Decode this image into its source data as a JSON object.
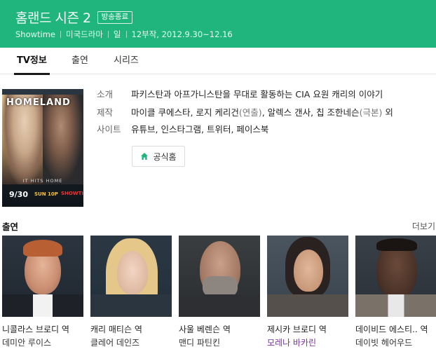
{
  "header": {
    "title": "홈랜드 시즌 2",
    "badge": "방송종료",
    "meta": [
      "Showtime",
      "미국드라마",
      "일",
      "12부작, 2012.9.30~12.16"
    ],
    "color": "#1fb57d"
  },
  "tabs": [
    {
      "label": "TV정보",
      "active": true
    },
    {
      "label": "출연",
      "active": false
    },
    {
      "label": "시리즈",
      "active": false
    }
  ],
  "poster": {
    "logo_text": "HOMELAND",
    "tagline": "IT HITS HOME",
    "date": "9/30",
    "date_sub": "SUN 10P",
    "network": "SHOWTIME"
  },
  "info": {
    "synopsis_label": "소개",
    "synopsis": "파키스탄과 아프가니스탄을 무대로 활동하는 CIA 요원 캐리의 이야기",
    "production_label": "제작",
    "production": {
      "person1": "마이클 쿠에스타",
      "person2": "로지 케리건",
      "person2_role": "(연출)",
      "person3": "알렉스 갠사",
      "person4": "칩 조한네슨",
      "person4_role": "(극본)",
      "suffix": "외"
    },
    "sites_label": "사이트",
    "sites": [
      "유튜브",
      "인스타그램",
      "트위터",
      "페이스북"
    ]
  },
  "home_button": {
    "label": "공식홈",
    "icon": "home-icon"
  },
  "cast": {
    "title": "출연",
    "more": "더보기",
    "members": [
      {
        "role": "니콜라스 브로디 역",
        "name": "데미안 루이스",
        "highlight": false
      },
      {
        "role": "캐리 매티슨 역",
        "name": "클레어 데인즈",
        "highlight": false
      },
      {
        "role": "사울 베렌슨 역",
        "name": "맨디 파틴킨",
        "highlight": false
      },
      {
        "role": "제시카 브로디 역",
        "name": "모레나 바카린",
        "highlight": true
      },
      {
        "role": "데이비드 에스티.. 역",
        "name": "데이빗 헤어우드",
        "highlight": false
      }
    ]
  }
}
